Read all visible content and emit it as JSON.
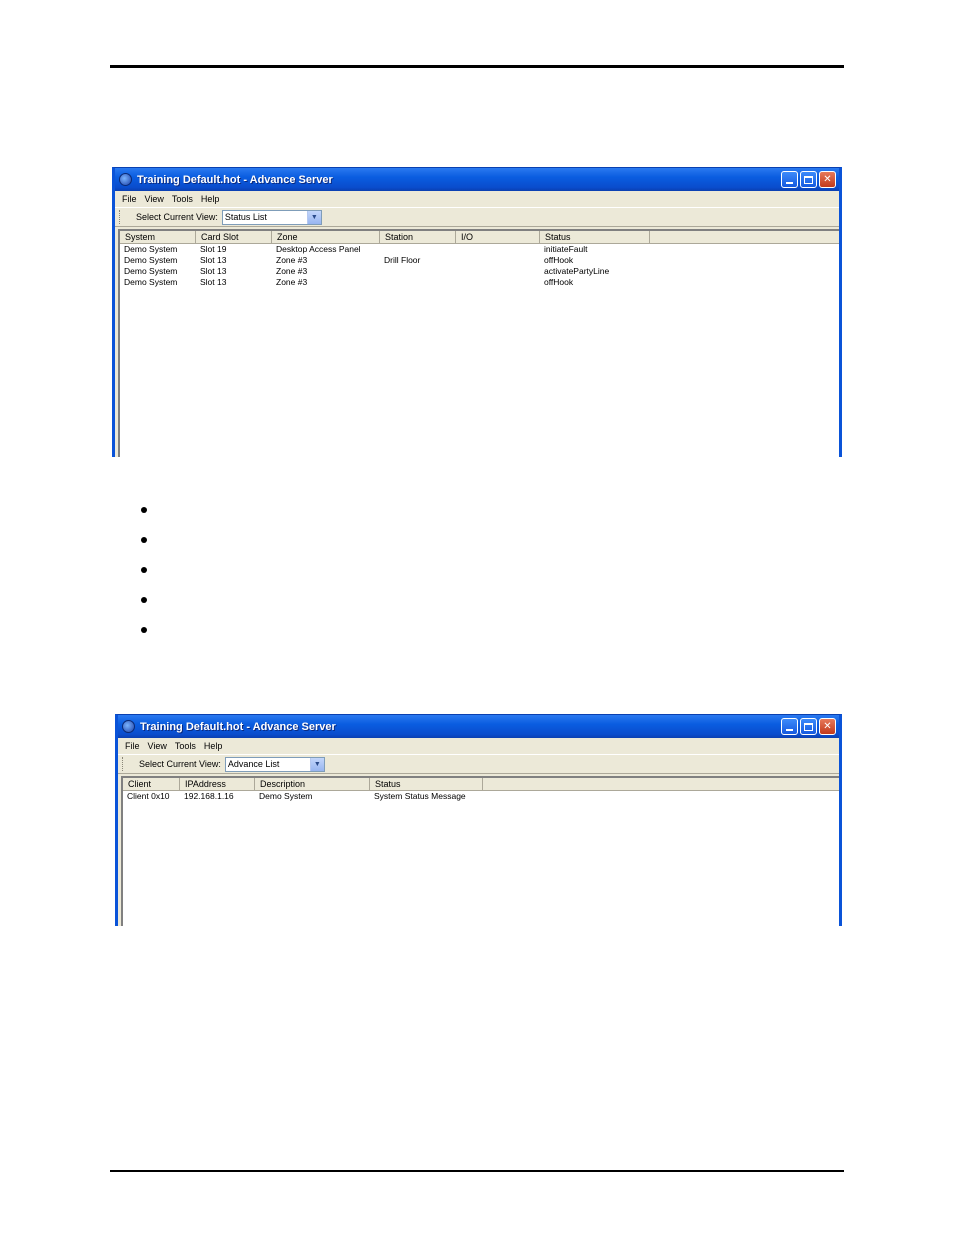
{
  "window1": {
    "title": "Training Default.hot - Advance Server",
    "menu": [
      "File",
      "View",
      "Tools",
      "Help"
    ],
    "toolbar": {
      "label": "Select Current View:",
      "selected": "Status List"
    },
    "columns": [
      "System",
      "Card Slot",
      "Zone",
      "Station",
      "I/O",
      "Status"
    ],
    "rows": [
      [
        "Demo System",
        "Slot 19",
        "Desktop Access Panel",
        "",
        "",
        "initiateFault"
      ],
      [
        "Demo System",
        "Slot 13",
        "Zone #3",
        "Drill Floor",
        "",
        "offHook"
      ],
      [
        "Demo System",
        "Slot 13",
        "Zone #3",
        "",
        "",
        "activatePartyLine"
      ],
      [
        "Demo System",
        "Slot 13",
        "Zone #3",
        "",
        "",
        "offHook"
      ]
    ]
  },
  "window2": {
    "title": "Training Default.hot - Advance Server",
    "menu": [
      "File",
      "View",
      "Tools",
      "Help"
    ],
    "toolbar": {
      "label": "Select Current View:",
      "selected": "Advance List"
    },
    "columns": [
      "Client",
      "IPAddress",
      "Description",
      "Status"
    ],
    "rows": [
      [
        "Client 0x10",
        "192.168.1.16",
        "Demo System",
        "System Status Message"
      ]
    ]
  },
  "icons": {
    "app": "advance-server-app-icon",
    "minimize": "minimize-icon",
    "maximize": "maximize-icon",
    "close": "close-icon",
    "dropdown": "chevron-down-icon"
  }
}
